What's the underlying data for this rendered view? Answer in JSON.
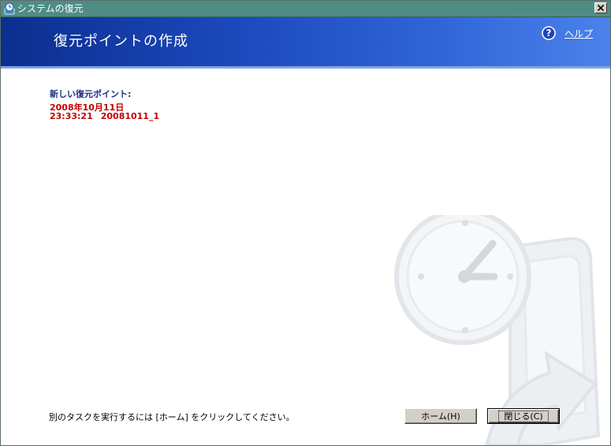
{
  "window": {
    "title": "システムの復元",
    "close_glyph": "×"
  },
  "header": {
    "page_title": "復元ポイントの作成",
    "help_label": "ヘルプ",
    "help_glyph": "?"
  },
  "restore_point": {
    "section_label": "新しい復元ポイント:",
    "date": "2008年10月11日",
    "time": "23:33:21",
    "name": "20081011_1"
  },
  "footer": {
    "instruction": "別のタスクを実行するには [ホーム] をクリックしてください。",
    "home_button": "ホーム(H)",
    "close_button": "閉じる(C)"
  },
  "colors": {
    "header_start": "#0b2f8f",
    "header_end": "#4b82ea",
    "title_bar": "#4f8c86",
    "restore_point_text": "#c40000",
    "section_label": "#1b2f7f"
  }
}
